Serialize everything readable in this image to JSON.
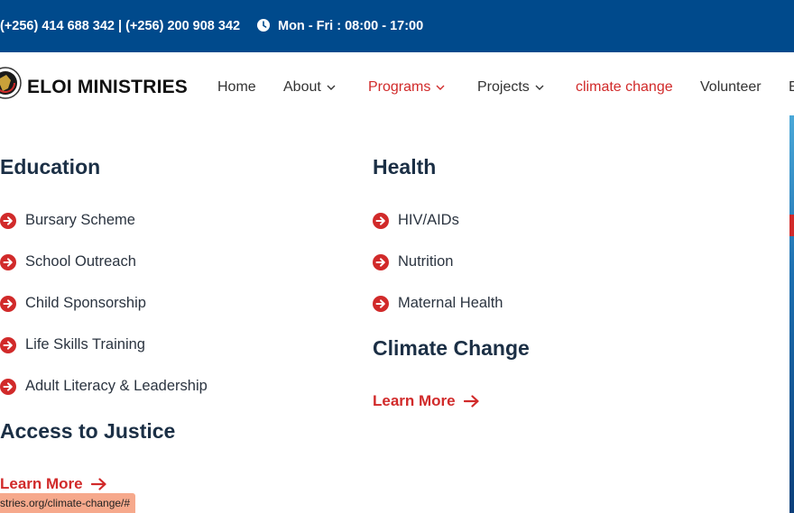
{
  "topbar": {
    "phones": "(+256) 414 688 342 | (+256) 200 908 342",
    "hours": "Mon - Fri : 08:00 - 17:00",
    "clock_icon": "clock-icon"
  },
  "header": {
    "brand": "ELOI MINISTRIES",
    "nav": [
      {
        "label": "Home"
      },
      {
        "label": "About"
      },
      {
        "label": "Programs"
      },
      {
        "label": "Projects"
      },
      {
        "label": "climate change"
      },
      {
        "label": "Volunteer"
      },
      {
        "label": "E"
      }
    ]
  },
  "mega": {
    "col1": {
      "heading1": "Education",
      "links": [
        "Bursary Scheme",
        "School Outreach",
        "Child Sponsorship",
        "Life Skills Training",
        "Adult Literacy & Leadership"
      ],
      "heading2": "Access to Justice",
      "learn_more": "Learn More"
    },
    "col2": {
      "heading1": "Health",
      "links": [
        "HIV/AIDs",
        "Nutrition",
        "Maternal Health"
      ],
      "heading2": "Climate Change",
      "learn_more": "Learn More"
    }
  },
  "status": {
    "url": "stries.org/climate-change/#"
  },
  "colors": {
    "topbar": "#004a8c",
    "accent": "#d12a2a",
    "heading": "#1b2f45"
  }
}
